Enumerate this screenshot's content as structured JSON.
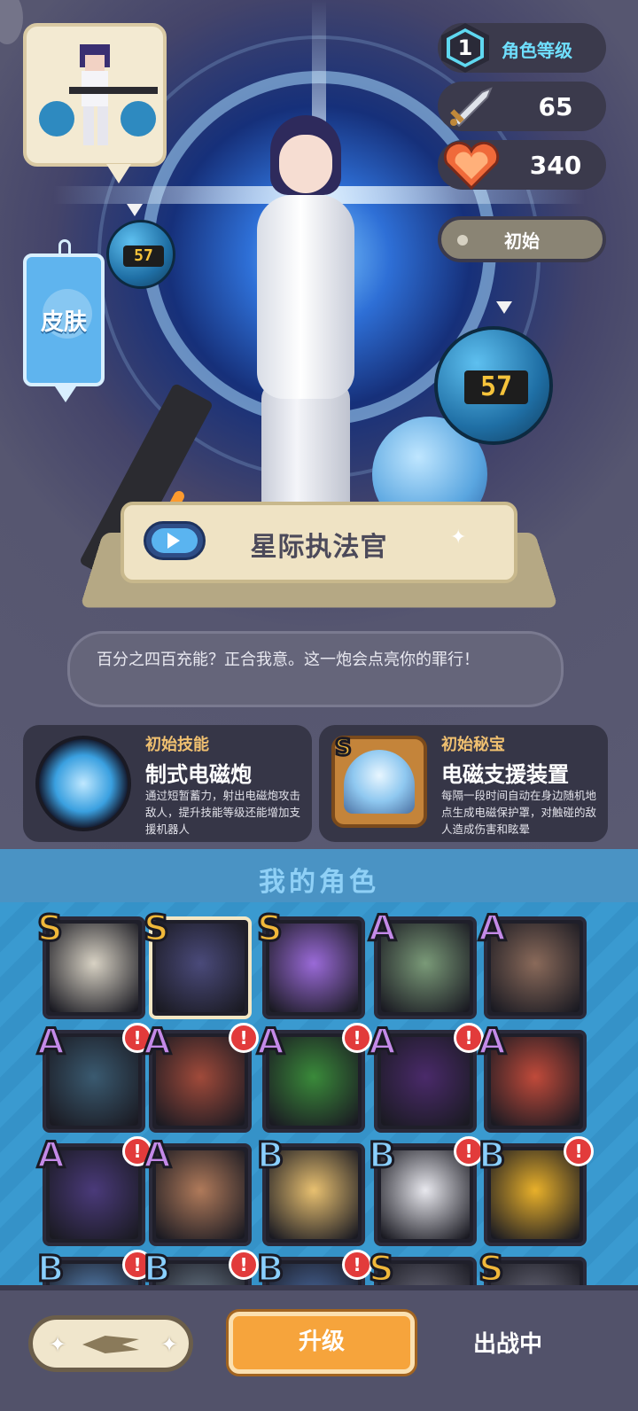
{
  "character": {
    "name": "星际执法官",
    "quote": "百分之四百充能？正合我意。这一炮会点亮你的罪行！",
    "level": "1",
    "level_label": "角色等级",
    "attack": "65",
    "health": "340",
    "skin_state": "初始",
    "orb_number": "57"
  },
  "skin_button": {
    "label": "皮肤"
  },
  "skills": [
    {
      "category": "初始技能",
      "name": "制式电磁炮",
      "description": "通过短暂蓄力，射出电磁炮攻击敌人，提升技能等级还能增加支援机器人",
      "icon": "railgun-icon"
    },
    {
      "category": "初始秘宝",
      "name": "电磁支援装置",
      "description": "每隔一段时间自动在身边随机地点生成电磁保护罩，对触碰的敌人造成伤害和眩晕",
      "icon": "shield-generator-icon",
      "rank": "S"
    }
  ],
  "roster": {
    "title": "我的角色",
    "tiles": [
      {
        "rank": "S",
        "alert": false,
        "selected": false,
        "color": "#d8d2c4"
      },
      {
        "rank": "S",
        "alert": false,
        "selected": true,
        "color": "#4a4a7a"
      },
      {
        "rank": "S",
        "alert": false,
        "selected": false,
        "color": "#9a6ad8"
      },
      {
        "rank": "A",
        "alert": false,
        "selected": false,
        "color": "#7a9a78"
      },
      {
        "rank": "A",
        "alert": false,
        "selected": false,
        "color": "#8a6a5a"
      },
      {
        "rank": "A",
        "alert": true,
        "selected": false,
        "color": "#3a5a70"
      },
      {
        "rank": "A",
        "alert": true,
        "selected": false,
        "color": "#a04a3a"
      },
      {
        "rank": "A",
        "alert": true,
        "selected": false,
        "color": "#3a8a3a"
      },
      {
        "rank": "A",
        "alert": true,
        "selected": false,
        "color": "#4a2a6a"
      },
      {
        "rank": "A",
        "alert": false,
        "selected": false,
        "color": "#c04a3a"
      },
      {
        "rank": "A",
        "alert": true,
        "selected": false,
        "color": "#4a3a7a"
      },
      {
        "rank": "A",
        "alert": false,
        "selected": false,
        "color": "#b07a5a"
      },
      {
        "rank": "B",
        "alert": false,
        "selected": false,
        "color": "#e8c070"
      },
      {
        "rank": "B",
        "alert": true,
        "selected": false,
        "color": "#e8e8ee"
      },
      {
        "rank": "B",
        "alert": true,
        "selected": false,
        "color": "#e8b02a"
      },
      {
        "rank": "B",
        "alert": true,
        "selected": false,
        "color": "#5a8ac0"
      },
      {
        "rank": "B",
        "alert": true,
        "selected": false,
        "color": "#6a7a8a"
      },
      {
        "rank": "B",
        "alert": true,
        "selected": false,
        "color": "#4a6aa0"
      },
      {
        "rank": "S",
        "alert": false,
        "selected": false,
        "color": "#6a6a7a"
      },
      {
        "rank": "S",
        "alert": false,
        "selected": false,
        "color": "#6a6a7a"
      }
    ]
  },
  "bottom_bar": {
    "upgrade_label": "升级",
    "status_label": "出战中"
  }
}
